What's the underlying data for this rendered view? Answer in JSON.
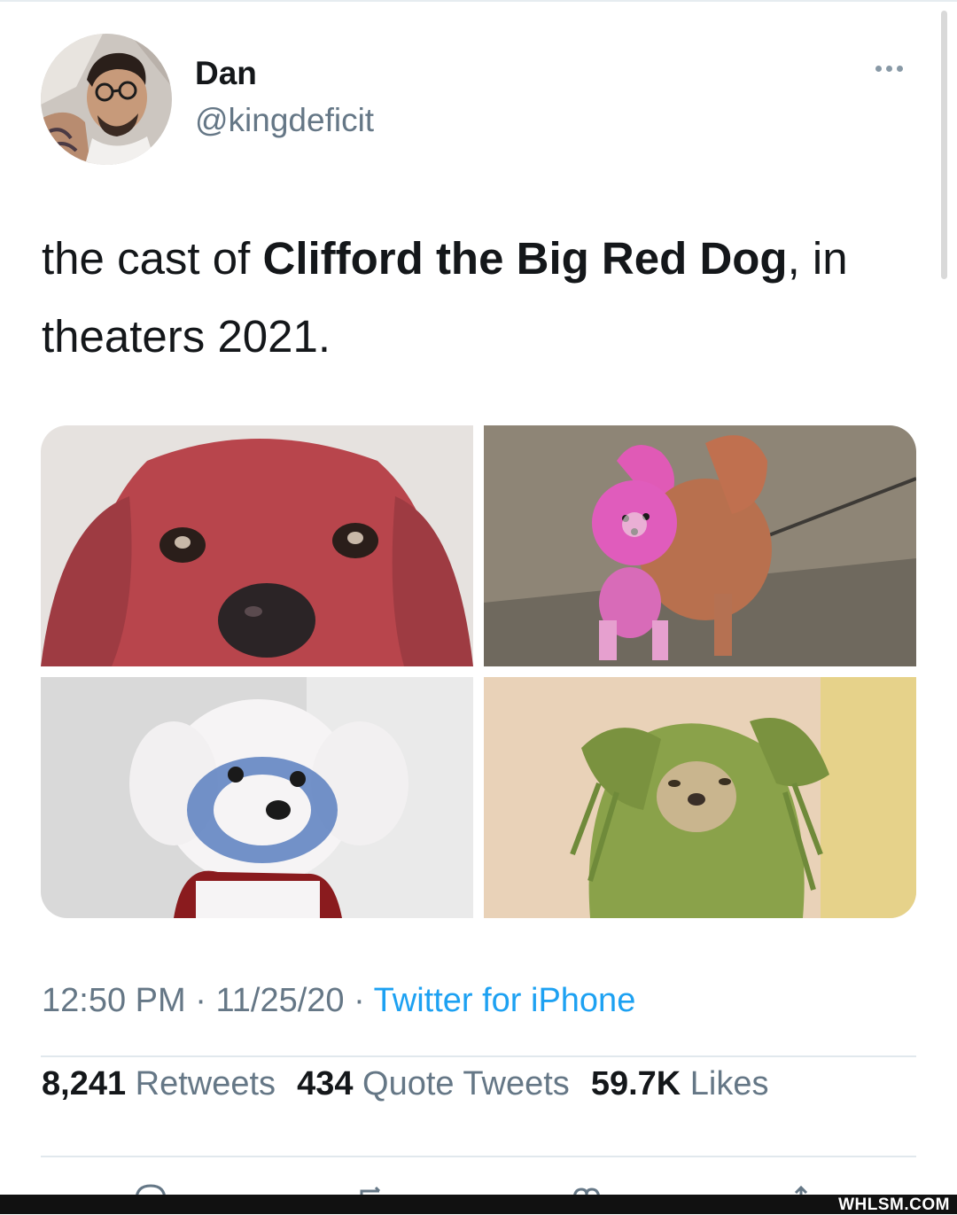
{
  "user": {
    "display_name": "Dan",
    "handle": "@kingdeficit",
    "avatar_icon": "profile-photo"
  },
  "tweet": {
    "text_1": "the cast of ",
    "text_bold": "Clifford the Big Red Dog",
    "text_2": ", in theaters 2021."
  },
  "media": [
    {
      "subject": "red-dog-closeup"
    },
    {
      "subject": "pink-pomeranian"
    },
    {
      "subject": "blue-white-poodle"
    },
    {
      "subject": "green-wet-dog"
    }
  ],
  "meta": {
    "time": "12:50 PM",
    "sep": " · ",
    "date": "11/25/20",
    "source": "Twitter for iPhone"
  },
  "stats": {
    "retweets_count": "8,241",
    "retweets_label": "Retweets",
    "quotes_count": "434",
    "quotes_label": "Quote Tweets",
    "likes_count": "59.7K",
    "likes_label": "Likes"
  },
  "watermark": "WHLSM.COM",
  "colors": {
    "link": "#1da1f2",
    "secondary_text": "#657786",
    "primary_text": "#14171a"
  }
}
